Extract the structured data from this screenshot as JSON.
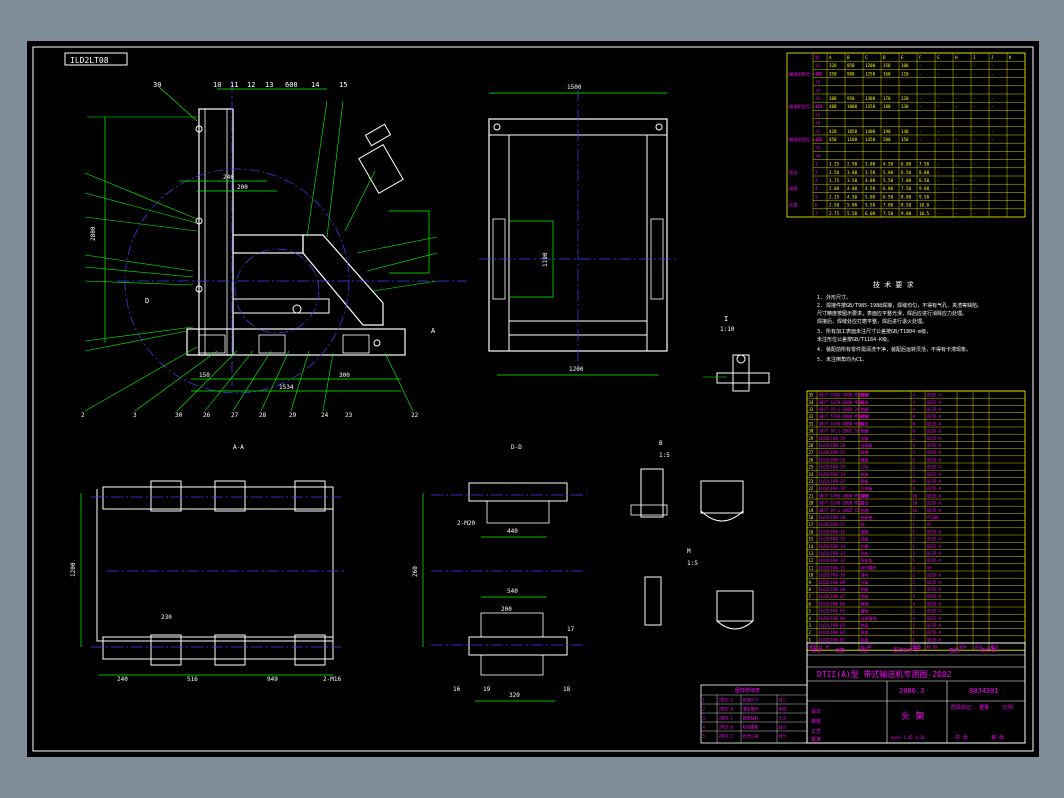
{
  "sheet": {
    "code_label": "ILD2LT08",
    "view_labels": {
      "aa": "A-A",
      "dd": "D-D"
    },
    "detail_c": {
      "label": "I",
      "scale": "1:5"
    },
    "detail_i": {
      "label": "I",
      "scale": "1:10"
    },
    "detail_b": {
      "label": "B",
      "scale": "1:5"
    },
    "detail_m": {
      "label": "M",
      "scale": "1:5"
    }
  },
  "dimensions": {
    "top_row": [
      "10",
      "11",
      "12",
      "13",
      "600",
      "14",
      "15"
    ],
    "top_left": "30",
    "front_dim_1": "240",
    "front_dim_2": "200",
    "front_height": "2800",
    "front_width": "1534",
    "front_bottom": [
      "150",
      "1534",
      "300"
    ],
    "front_part_nos": [
      "2",
      "3",
      "30",
      "26",
      "27",
      "28",
      "29",
      "24",
      "23",
      "22"
    ],
    "right_width": "1500",
    "right_bottom": "1200",
    "right_side": "1190",
    "aa_width": [
      "240",
      "516",
      "949"
    ],
    "aa_height": "1200",
    "aa_cut": "230",
    "aa_note": "2-M16",
    "dd_width": [
      "440",
      "540"
    ],
    "dd_height": [
      "260",
      "200",
      "320"
    ],
    "dd_labels": [
      "2-M20",
      "16",
      "19",
      "18",
      "17"
    ]
  },
  "leaders": [
    "8",
    "9",
    "10",
    "11",
    "12",
    "6",
    "7",
    "5",
    "4",
    "3",
    "2",
    "1",
    "19",
    "20",
    "21",
    "18",
    "17",
    "16",
    "27",
    "24",
    "31",
    "32",
    "33",
    "34",
    "35"
  ],
  "tech_requirements": {
    "title": "技 术 要 求",
    "items": [
      "1. 外形尺寸。",
      "2. 焊接件按GB/T985-1988焊接，焊缝均匀，不得有气孔、夹渣等缺陷。",
      "   尺寸精度按图示要求，表面应平整光滑，焊后应进行消除应力处理。",
      "   焊接后，焊缝处应打磨平整，焊后进行退火处理。",
      "3. 所有加工表面未注尺寸公差按GB/T1804-m级，",
      "   未注形位公差按GB/T1184-K级。",
      "4. 装配前所有零件需清洗干净，装配后运转灵活，不得有卡滞现象。",
      "5. 未注倒角均为C1。"
    ]
  },
  "param_table": {
    "header": [
      "型",
      "A",
      "B",
      "C",
      "D",
      "E",
      "F",
      "G",
      "H",
      "I",
      "J",
      "K"
    ],
    "groups": [
      {
        "label": "输送机型号 ×100",
        "rows": [
          [
            "+1",
            "320",
            "850",
            "1200",
            "150",
            "100",
            "-",
            "-",
            "-",
            "-",
            "-"
          ],
          [
            "+2",
            "350",
            "900",
            "1250",
            "160",
            "110",
            "-",
            "-",
            "-",
            "-",
            "-"
          ],
          [
            "+3",
            "",
            "",
            "",
            "",
            "",
            "",
            "",
            "",
            "",
            ""
          ],
          [
            "+4",
            "",
            "",
            "",
            "",
            "",
            "",
            "",
            "",
            "",
            ""
          ]
        ]
      },
      {
        "label": "输送机型号 ×120",
        "rows": [
          [
            "+1",
            "380",
            "950",
            "1300",
            "170",
            "120",
            "-",
            "-",
            "-",
            "-",
            "-"
          ],
          [
            "+2",
            "400",
            "1000",
            "1350",
            "180",
            "130",
            "-",
            "-",
            "-",
            "-",
            "-"
          ],
          [
            "+3",
            "",
            "",
            "",
            "",
            "",
            "",
            "",
            "",
            "",
            ""
          ],
          [
            "+4",
            "",
            "",
            "",
            "",
            "",
            "",
            "",
            "",
            "",
            ""
          ]
        ]
      },
      {
        "label": "输送机型号 ×140",
        "rows": [
          [
            "+1",
            "420",
            "1050",
            "1400",
            "190",
            "140",
            "-",
            "-",
            "-",
            "-",
            "-"
          ],
          [
            "+2",
            "450",
            "1100",
            "1450",
            "200",
            "150",
            "-",
            "-",
            "-",
            "-",
            "-"
          ],
          [
            "+3",
            "",
            "",
            "",
            "",
            "",
            "",
            "",
            "",
            "",
            ""
          ],
          [
            "+4",
            "",
            "",
            "",
            "",
            "",
            "",
            "",
            "",
            "",
            ""
          ]
        ]
      }
    ],
    "bottom_rows": [
      [
        "1",
        "1.25",
        "2.50",
        "3.00",
        "4.50",
        "6.00",
        "7.50",
        "-",
        "-",
        "-"
      ],
      [
        "2",
        "1.50",
        "3.00",
        "3.50",
        "5.00",
        "6.50",
        "8.00",
        "-",
        "-",
        "-"
      ],
      [
        "3",
        "1.75",
        "3.50",
        "4.00",
        "5.50",
        "7.00",
        "8.50",
        "-",
        "-",
        "-"
      ],
      [
        "4",
        "2.00",
        "4.00",
        "4.50",
        "6.00",
        "7.50",
        "9.00",
        "-",
        "-",
        "-"
      ],
      [
        "5",
        "2.25",
        "4.50",
        "5.00",
        "6.50",
        "8.00",
        "9.50",
        "-",
        "-",
        "-"
      ],
      [
        "6",
        "2.50",
        "5.00",
        "5.50",
        "7.00",
        "8.50",
        "10.0",
        "-",
        "-",
        "-"
      ],
      [
        "7",
        "2.75",
        "5.50",
        "6.00",
        "7.50",
        "9.00",
        "10.5",
        "-",
        "-",
        "-"
      ]
    ],
    "bottom_group_labels": [
      "驱动",
      "滚筒",
      "托辊"
    ]
  },
  "bom": {
    "rows": [
      [
        "35",
        "GB/T 5783-2000 M20×60",
        "螺栓",
        "4",
        "Q235-A",
        "",
        ""
      ],
      [
        "34",
        "GB/T 6170-2000 M20",
        "螺母",
        "4",
        "Q235-A",
        "",
        ""
      ],
      [
        "33",
        "GB/T 97.1-2002 20",
        "垫圈",
        "4",
        "Q235-A",
        "",
        ""
      ],
      [
        "32",
        "GB/T 5783-2000 M16×50",
        "螺栓",
        "8",
        "Q235-A",
        "",
        ""
      ],
      [
        "31",
        "GB/T 6170-2000 M16",
        "螺母",
        "8",
        "Q235-A",
        "",
        ""
      ],
      [
        "30",
        "GB/T 97.1-2002 16",
        "垫圈",
        "8",
        "Q235-A",
        "",
        ""
      ],
      [
        "29",
        "ILD2LT08-29",
        "支腿",
        "2",
        "Q235-A",
        "",
        ""
      ],
      [
        "28",
        "ILD2LT08-28",
        "连接板",
        "4",
        "Q235-A",
        "",
        ""
      ],
      [
        "27",
        "ILD2LT08-27",
        "斜撑",
        "2",
        "Q235-A",
        "",
        ""
      ],
      [
        "26",
        "ILD2LT08-26",
        "横梁",
        "2",
        "Q235-A",
        "",
        ""
      ],
      [
        "25",
        "ILD2LT08-25",
        "立柱",
        "2",
        "Q235-A",
        "",
        ""
      ],
      [
        "24",
        "ILD2LT08-24",
        "底座",
        "2",
        "Q235-A",
        "",
        ""
      ],
      [
        "23",
        "ILD2LT08-23",
        "筋板",
        "8",
        "Q235-A",
        "",
        ""
      ],
      [
        "22",
        "ILD2LT08-22",
        "支承板",
        "4",
        "Q235-A",
        "",
        ""
      ],
      [
        "21",
        "GB/T 5783-2000 M12×40",
        "螺栓",
        "16",
        "Q235-A",
        "",
        ""
      ],
      [
        "20",
        "GB/T 6170-2000 M12",
        "螺母",
        "16",
        "Q235-A",
        "",
        ""
      ],
      [
        "19",
        "GB/T 97.1-2002 12",
        "垫圈",
        "16",
        "Q235-A",
        "",
        ""
      ],
      [
        "18",
        "ILD2LT08-18",
        "轴承座",
        "2",
        "HT200",
        "",
        ""
      ],
      [
        "17",
        "ILD2LT08-17",
        "轴",
        "1",
        "45",
        "",
        ""
      ],
      [
        "16",
        "ILD2LT08-16",
        "滚筒",
        "1",
        "Q235-A",
        "",
        ""
      ],
      [
        "15",
        "ILD2LT08-15",
        "挡板",
        "2",
        "Q235-A",
        "",
        ""
      ],
      [
        "14",
        "ILD2LT08-14",
        "护罩",
        "1",
        "Q235-A",
        "",
        ""
      ],
      [
        "13",
        "ILD2LT08-13",
        "导轨",
        "2",
        "Q235-A",
        "",
        ""
      ],
      [
        "12",
        "ILD2LT08-12",
        "张紧架",
        "1",
        "Q235-A",
        "",
        ""
      ],
      [
        "11",
        "ILD2LT08-11",
        "调节螺杆",
        "2",
        "45",
        "",
        ""
      ],
      [
        "10",
        "ILD2LT08-10",
        "滑块",
        "2",
        "Q235-A",
        "",
        ""
      ],
      [
        "9",
        "ILD2LT08-09",
        "托架",
        "2",
        "Q235-A",
        "",
        ""
      ],
      [
        "8",
        "ILD2LT08-08",
        "侧板",
        "2",
        "Q235-A",
        "",
        ""
      ],
      [
        "7",
        "ILD2LT08-07",
        "垫板",
        "4",
        "Q235-A",
        "",
        ""
      ],
      [
        "6",
        "ILD2LT08-06",
        "角钢",
        "4",
        "Q235-A",
        "",
        ""
      ],
      [
        "5",
        "ILD2LT08-05",
        "槽钢",
        "2",
        "Q235-A",
        "",
        ""
      ],
      [
        "4",
        "ILD2LT08-04",
        "连接角钢",
        "4",
        "Q235-A",
        "",
        ""
      ],
      [
        "3",
        "ILD2LT08-03",
        "底梁",
        "2",
        "Q235-A",
        "",
        ""
      ],
      [
        "2",
        "ILD2LT08-02",
        "前梁",
        "1",
        "Q235-A",
        "",
        ""
      ],
      [
        "1",
        "ILD2LT08-01",
        "机架",
        "1",
        "Q235-A",
        "",
        ""
      ]
    ],
    "header": [
      "序号",
      "代  号",
      "名  称",
      "数量",
      "材  料",
      "单件",
      "总计",
      "备注"
    ]
  },
  "title_block": {
    "series": "DTII(A)型 带式输送机专用图-2002",
    "drawing_no": "2000.3",
    "part_code": "80J4301",
    "name": "头  架",
    "small_note": "mass 1.45 1:10",
    "labels": [
      "标记",
      "处数",
      "分区",
      "更改文件号",
      "签名",
      "年月日"
    ],
    "role_labels": [
      "设计",
      "审核",
      "工艺",
      "批准"
    ],
    "right_labels": [
      "阶段标记",
      "重量",
      "比例"
    ],
    "sheet_labels": [
      "共 张",
      "第 张"
    ]
  },
  "revision_block": {
    "title": "图样修改表",
    "rows": [
      [
        "1",
        "2002.5",
        "修改尺寸",
        "张三"
      ],
      [
        "2",
        "2002.8",
        "增加零件",
        "李四"
      ],
      [
        "3",
        "2003.1",
        "修改材料",
        "王五"
      ],
      [
        "4",
        "2003.6",
        "标准更新",
        "赵六"
      ],
      [
        "5",
        "2004.2",
        "修改公差",
        "钱七"
      ]
    ]
  },
  "colors": {
    "background": "#7f8c99",
    "sheet": "#000000",
    "outline": "#ffffff",
    "dimension": "#00ff00",
    "centerline": "#4040ff",
    "text_table": "#ffff00",
    "text_magenta": "#ff00ff",
    "text_cyan": "#00ffff"
  }
}
